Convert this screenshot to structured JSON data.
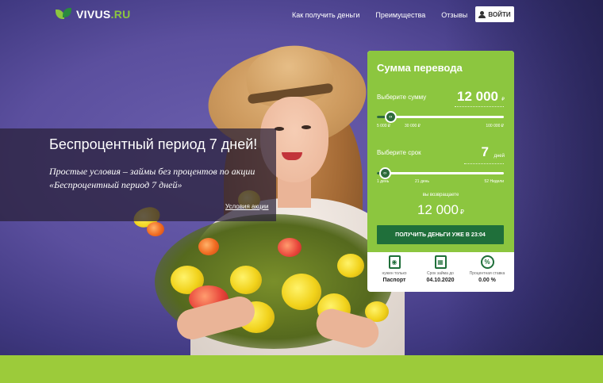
{
  "header": {
    "logo_main": "VIVUS",
    "logo_suffix": ".RU",
    "nav": [
      "Как получить деньги",
      "Преимущества",
      "Отзывы"
    ],
    "login_label": "ВОЙТИ"
  },
  "promo": {
    "title": "Беспроцентный период 7 дней!",
    "text": "Простые условия – займы без процентов по акции «Беспроцентный период 7 дней»",
    "link": "Условия акции"
  },
  "calculator": {
    "title": "Сумма перевода",
    "amount_label": "Выберите сумму",
    "amount_value": "12 000",
    "amount_unit": "₽",
    "amount_progress": 0.055,
    "amount_ticks": [
      "5 000 ₽",
      "30 000 ₽",
      "100 000 ₽"
    ],
    "term_label": "Выберите срок",
    "term_value": "7",
    "term_unit": "дней",
    "term_progress": 0.04,
    "term_ticks": [
      "1 день",
      "21 день",
      "52 Недели"
    ],
    "knob_icon": "‹›",
    "return_label": "вы возвращаете",
    "return_value": "12 000",
    "return_unit": "₽",
    "submit_label": "ПОЛУЧИТЬ ДЕНЬГИ УЖЕ В 23:04",
    "info": [
      {
        "icon": "passport-icon",
        "glyph": "◉",
        "caption": "нужен только",
        "value": "Паспорт"
      },
      {
        "icon": "calendar-icon",
        "glyph": "▦",
        "caption": "Срок займа до",
        "value": "04.10.2020"
      },
      {
        "icon": "percent-icon",
        "glyph": "%",
        "caption": "Процентная ставка",
        "value": "0.00 %"
      }
    ]
  },
  "colors": {
    "brand_green": "#8cc63f",
    "dark_green": "#1f6f3a",
    "hero_purple": "#5b4f9e"
  }
}
